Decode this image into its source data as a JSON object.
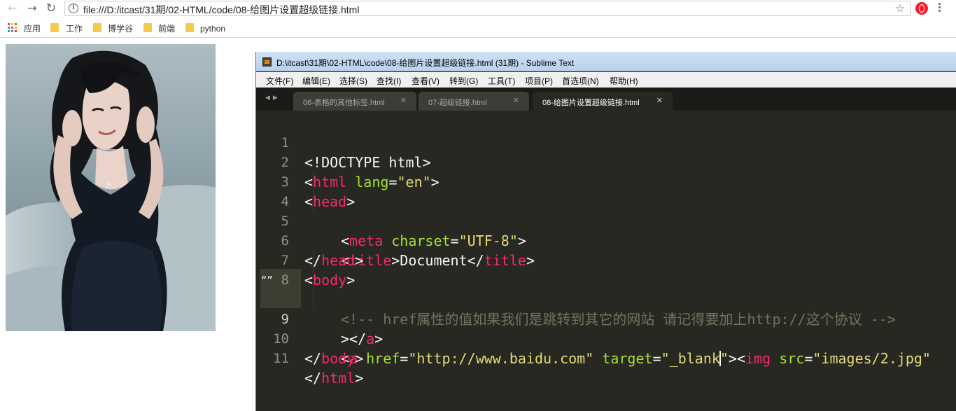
{
  "browser": {
    "url": "file:///D:/itcast/31期/02-HTML/code/08-给图片设置超级链接.html",
    "bookmarks": [
      {
        "label": "应用"
      },
      {
        "label": "工作"
      },
      {
        "label": "博学谷"
      },
      {
        "label": "前端"
      },
      {
        "label": "python"
      }
    ]
  },
  "page": {
    "image_alt": "photo"
  },
  "sublime": {
    "title": "D:\\itcast\\31期\\02-HTML\\code\\08-给图片设置超级链接.html (31期) - Sublime Text",
    "menu": [
      "文件(F)",
      "编辑(E)",
      "选择(S)",
      "查找(I)",
      "查看(V)",
      "转到(G)",
      "工具(T)",
      "项目(P)",
      "首选项(N)",
      "帮助(H)"
    ],
    "tabs": [
      {
        "label": "06-表格的其他标签.html",
        "active": false
      },
      {
        "label": "07-超级链接.html",
        "active": false
      },
      {
        "label": "08-给图片设置超级链接.html",
        "active": true
      }
    ],
    "code": {
      "l1": {
        "n": "1",
        "a": "<!DOCTYPE html>"
      },
      "l2": {
        "n": "2",
        "a": "<",
        "b": "html",
        "c": " lang",
        "d": "=",
        "e": "\"en\"",
        "f": ">"
      },
      "l3": {
        "n": "3",
        "a": "<",
        "b": "head",
        "c": ">"
      },
      "l4": {
        "n": "4",
        "a": "<",
        "b": "meta",
        "c": " charset",
        "d": "=",
        "e": "\"UTF-8\"",
        "f": ">"
      },
      "l5": {
        "n": "5",
        "a": "<",
        "b": "title",
        "c": ">Document</",
        "d": "title",
        "e": ">"
      },
      "l6": {
        "n": "6",
        "a": "</",
        "b": "head",
        "c": ">"
      },
      "l7": {
        "n": "7",
        "a": "<",
        "b": "body",
        "c": ">"
      },
      "l8": {
        "n": "8",
        "a": "<!-- href属性的值如果我们是跳转到其它的网站 请记得要加上http://这个协议 -->"
      },
      "l9": {
        "n": "9",
        "fold": "“”",
        "a": "<",
        "b": "a",
        "c": " href",
        "d": "=",
        "e": "\"http://www.baidu.com\"",
        "f": " target",
        "g": "=",
        "h": "\"_blank",
        "i": "\"",
        "j": "><",
        "k": "img",
        "l": " src",
        "m": "=",
        "o": "\"images/2.jpg\""
      },
      "l9b": {
        "a": "></",
        "b": "a",
        "c": ">"
      },
      "l10": {
        "n": "10",
        "a": "</",
        "b": "body",
        "c": ">"
      },
      "l11": {
        "n": "11",
        "a": "</",
        "b": "html",
        "c": ">"
      }
    }
  },
  "colors": {
    "editor_bg": "#272822",
    "tag": "#f92672",
    "attr": "#a6e22e",
    "string": "#e6db74",
    "comment": "#75715e"
  }
}
